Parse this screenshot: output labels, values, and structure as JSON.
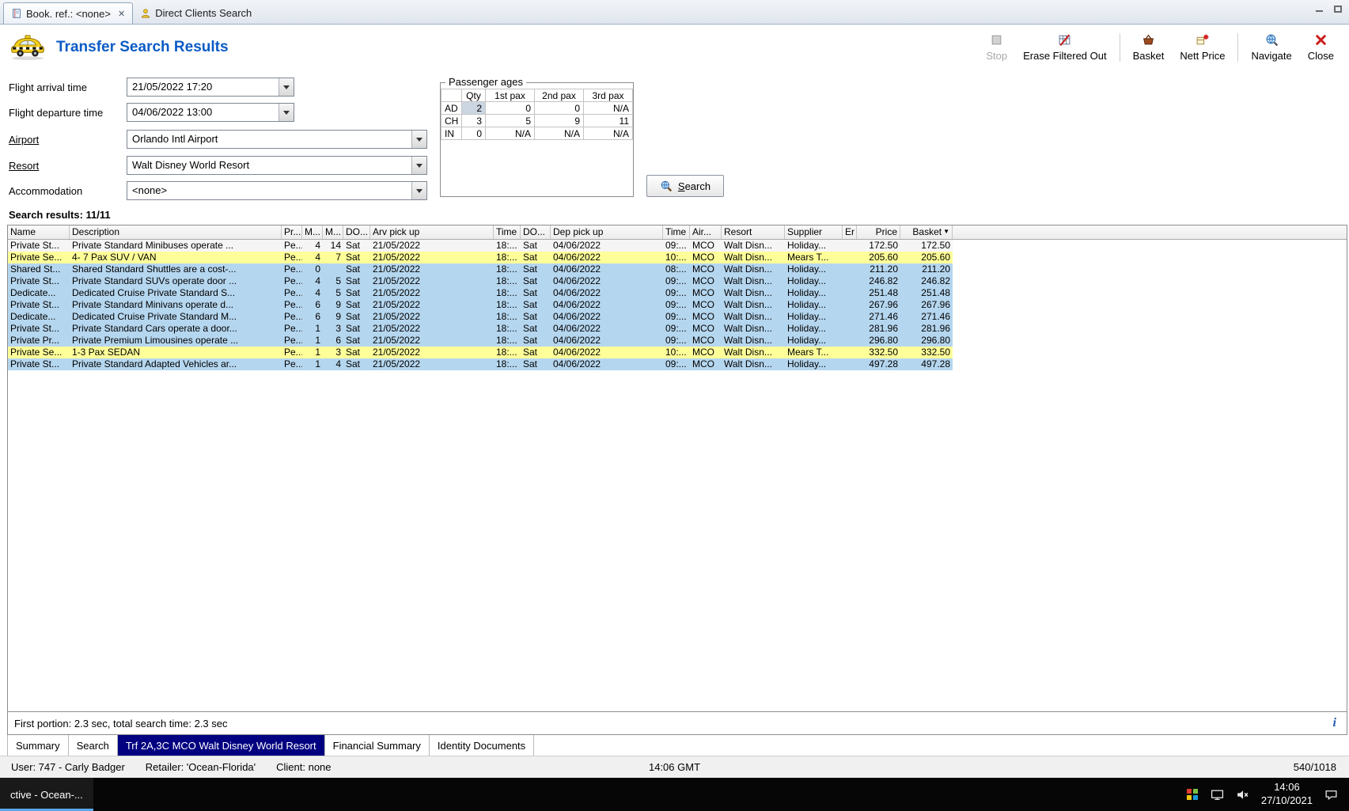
{
  "tabbar": {
    "tabs": [
      {
        "label": "Book. ref.: <none>",
        "icon": "book",
        "active": true,
        "closable": true
      },
      {
        "label": "Direct Clients Search",
        "icon": "person",
        "active": false,
        "closable": false
      }
    ]
  },
  "header": {
    "title": "Transfer Search Results",
    "toolbar": [
      {
        "label": "Stop",
        "icon": "stop",
        "disabled": true,
        "separator_after": false
      },
      {
        "label": "Erase Filtered Out",
        "icon": "erase-filtered",
        "disabled": false,
        "separator_after": true
      },
      {
        "label": "Basket",
        "icon": "basket",
        "disabled": false,
        "separator_after": false
      },
      {
        "label": "Nett Price",
        "icon": "nett-price",
        "disabled": false,
        "separator_after": true
      },
      {
        "label": "Navigate",
        "icon": "navigate",
        "disabled": false,
        "separator_after": false
      },
      {
        "label": "Close",
        "icon": "close",
        "disabled": false,
        "separator_after": false
      }
    ]
  },
  "search_form": {
    "fields": [
      {
        "label": "Flight arrival time",
        "value": "21/05/2022 17:20",
        "link": false,
        "wide": false
      },
      {
        "label": "Flight departure time",
        "value": "04/06/2022 13:00",
        "link": false,
        "wide": false
      },
      {
        "label": "Airport",
        "value": "Orlando Intl Airport",
        "link": true,
        "wide": true
      },
      {
        "label": "Resort",
        "value": "Walt Disney World Resort",
        "link": true,
        "wide": true
      },
      {
        "label": "Accommodation",
        "value": "<none>",
        "link": false,
        "wide": true
      }
    ],
    "search_button": "Search"
  },
  "passenger_ages": {
    "title": "Passenger ages",
    "columns": [
      "",
      "Qty",
      "1st pax",
      "2nd pax",
      "3rd pax"
    ],
    "rows": [
      {
        "label": "AD",
        "values": [
          "2",
          "0",
          "0",
          "N/A"
        ],
        "qty_selected": true
      },
      {
        "label": "CH",
        "values": [
          "3",
          "5",
          "9",
          "11"
        ],
        "qty_selected": false
      },
      {
        "label": "IN",
        "values": [
          "0",
          "N/A",
          "N/A",
          "N/A"
        ],
        "qty_selected": false
      }
    ]
  },
  "results": {
    "summary": "Search results: 11/11",
    "columns": [
      {
        "label": "Name"
      },
      {
        "label": "Description"
      },
      {
        "label": "Pr..."
      },
      {
        "label": "M..."
      },
      {
        "label": "M..."
      },
      {
        "label": "DO..."
      },
      {
        "label": "Arv pick up"
      },
      {
        "label": "Time"
      },
      {
        "label": "DO..."
      },
      {
        "label": "Dep pick up"
      },
      {
        "label": "Time"
      },
      {
        "label": "Air..."
      },
      {
        "label": "Resort"
      },
      {
        "label": "Supplier"
      },
      {
        "label": "Er"
      },
      {
        "label": "Price"
      },
      {
        "label": "Basket",
        "sort": "desc"
      }
    ],
    "rows": [
      {
        "highlight": "white",
        "cells": [
          "Private St...",
          "Private Standard Minibuses operate ...",
          "Pe...",
          "4",
          "14",
          "Sat",
          "21/05/2022",
          "18:...",
          "Sat",
          "04/06/2022",
          "09:...",
          "MCO",
          "Walt Disn...",
          "Holiday...",
          "",
          "172.50",
          "172.50"
        ]
      },
      {
        "highlight": "yellow",
        "cells": [
          "Private Se...",
          "4- 7 Pax SUV / VAN",
          "Pe...",
          "4",
          "7",
          "Sat",
          "21/05/2022",
          "18:...",
          "Sat",
          "04/06/2022",
          "10:...",
          "MCO",
          "Walt Disn...",
          "Mears T...",
          "",
          "205.60",
          "205.60"
        ]
      },
      {
        "highlight": "blue",
        "cells": [
          "Shared St...",
          "Shared Standard Shuttles are a cost-...",
          "Pe...",
          "0",
          "",
          "Sat",
          "21/05/2022",
          "18:...",
          "Sat",
          "04/06/2022",
          "08:...",
          "MCO",
          "Walt Disn...",
          "Holiday...",
          "",
          "211.20",
          "211.20"
        ]
      },
      {
        "highlight": "blue",
        "cells": [
          "Private St...",
          "Private Standard SUVs operate door ...",
          "Pe...",
          "4",
          "5",
          "Sat",
          "21/05/2022",
          "18:...",
          "Sat",
          "04/06/2022",
          "09:...",
          "MCO",
          "Walt Disn...",
          "Holiday...",
          "",
          "246.82",
          "246.82"
        ]
      },
      {
        "highlight": "blue",
        "cells": [
          "Dedicate...",
          "Dedicated Cruise Private Standard S...",
          "Pe...",
          "4",
          "5",
          "Sat",
          "21/05/2022",
          "18:...",
          "Sat",
          "04/06/2022",
          "09:...",
          "MCO",
          "Walt Disn...",
          "Holiday...",
          "",
          "251.48",
          "251.48"
        ]
      },
      {
        "highlight": "blue",
        "cells": [
          "Private St...",
          "Private Standard Minivans operate d...",
          "Pe...",
          "6",
          "9",
          "Sat",
          "21/05/2022",
          "18:...",
          "Sat",
          "04/06/2022",
          "09:...",
          "MCO",
          "Walt Disn...",
          "Holiday...",
          "",
          "267.96",
          "267.96"
        ]
      },
      {
        "highlight": "blue",
        "cells": [
          "Dedicate...",
          "Dedicated Cruise Private Standard M...",
          "Pe...",
          "6",
          "9",
          "Sat",
          "21/05/2022",
          "18:...",
          "Sat",
          "04/06/2022",
          "09:...",
          "MCO",
          "Walt Disn...",
          "Holiday...",
          "",
          "271.46",
          "271.46"
        ]
      },
      {
        "highlight": "blue",
        "cells": [
          "Private St...",
          "Private Standard Cars operate a door...",
          "Pe...",
          "1",
          "3",
          "Sat",
          "21/05/2022",
          "18:...",
          "Sat",
          "04/06/2022",
          "09:...",
          "MCO",
          "Walt Disn...",
          "Holiday...",
          "",
          "281.96",
          "281.96"
        ]
      },
      {
        "highlight": "blue",
        "cells": [
          "Private Pr...",
          "Private Premium Limousines operate ...",
          "Pe...",
          "1",
          "6",
          "Sat",
          "21/05/2022",
          "18:...",
          "Sat",
          "04/06/2022",
          "09:...",
          "MCO",
          "Walt Disn...",
          "Holiday...",
          "",
          "296.80",
          "296.80"
        ]
      },
      {
        "highlight": "yellow",
        "cells": [
          "Private Se...",
          "1-3 Pax SEDAN",
          "Pe...",
          "1",
          "3",
          "Sat",
          "21/05/2022",
          "18:...",
          "Sat",
          "04/06/2022",
          "10:...",
          "MCO",
          "Walt Disn...",
          "Mears T...",
          "",
          "332.50",
          "332.50"
        ]
      },
      {
        "highlight": "blue",
        "cells": [
          "Private St...",
          "Private Standard Adapted Vehicles ar...",
          "Pe...",
          "1",
          "4",
          "Sat",
          "21/05/2022",
          "18:...",
          "Sat",
          "04/06/2022",
          "09:...",
          "MCO",
          "Walt Disn...",
          "Holiday...",
          "",
          "497.28",
          "497.28"
        ]
      }
    ],
    "timing": "First portion: 2.3 sec, total search time: 2.3 sec",
    "info_icon": "i"
  },
  "bottom_tabs": [
    {
      "label": "Summary",
      "active": false
    },
    {
      "label": "Search",
      "active": false
    },
    {
      "label": "Trf 2A,3C MCO Walt Disney World Resort",
      "active": true
    },
    {
      "label": "Financial Summary",
      "active": false
    },
    {
      "label": "Identity Documents",
      "active": false
    }
  ],
  "statusbar": {
    "user": "User: 747 - Carly Badger",
    "retailer": "Retailer: 'Ocean-Florida'",
    "client": "Client: none",
    "time": "14:06 GMT",
    "counter": "540/1018"
  },
  "taskbar": {
    "app_button": "ctive - Ocean-...",
    "clock_time": "14:06",
    "clock_date": "27/10/2021"
  },
  "colors": {
    "title_blue": "#0c5bc5",
    "row_blue": "#b5d6ef",
    "row_yellow": "#ffff99",
    "row_plain": "#f5f5f5",
    "active_bottom_tab_bg": "#000080",
    "close_red": "#cc2020"
  }
}
